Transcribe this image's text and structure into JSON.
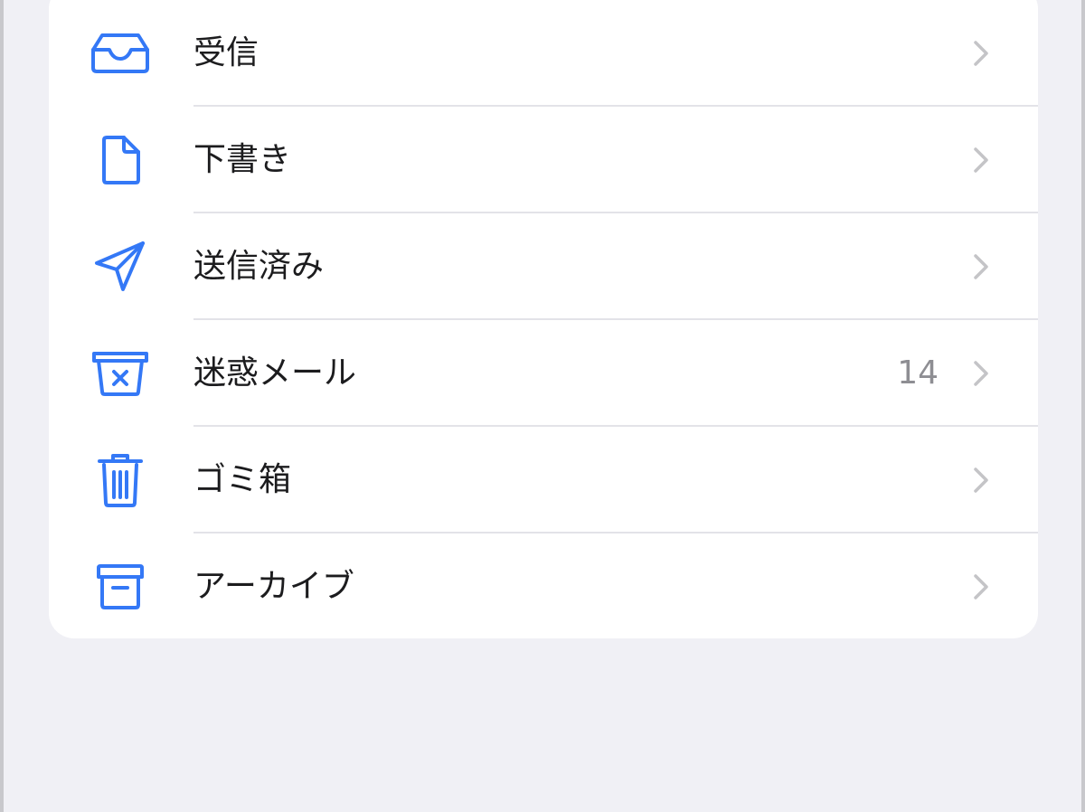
{
  "colors": {
    "accent": "#3478f6",
    "background": "#f0f0f5",
    "card": "#ffffff",
    "text": "#1c1c1e",
    "secondary_text": "#8e8e93",
    "chevron": "#c4c4c7",
    "separator": "#e3e3e8"
  },
  "mailboxes": [
    {
      "label": "受信",
      "icon": "inbox-icon",
      "count": ""
    },
    {
      "label": "下書き",
      "icon": "document-icon",
      "count": ""
    },
    {
      "label": "送信済み",
      "icon": "paperplane-icon",
      "count": ""
    },
    {
      "label": "迷惑メール",
      "icon": "junk-icon",
      "count": "14"
    },
    {
      "label": "ゴミ箱",
      "icon": "trash-icon",
      "count": ""
    },
    {
      "label": "アーカイブ",
      "icon": "archive-icon",
      "count": ""
    }
  ]
}
